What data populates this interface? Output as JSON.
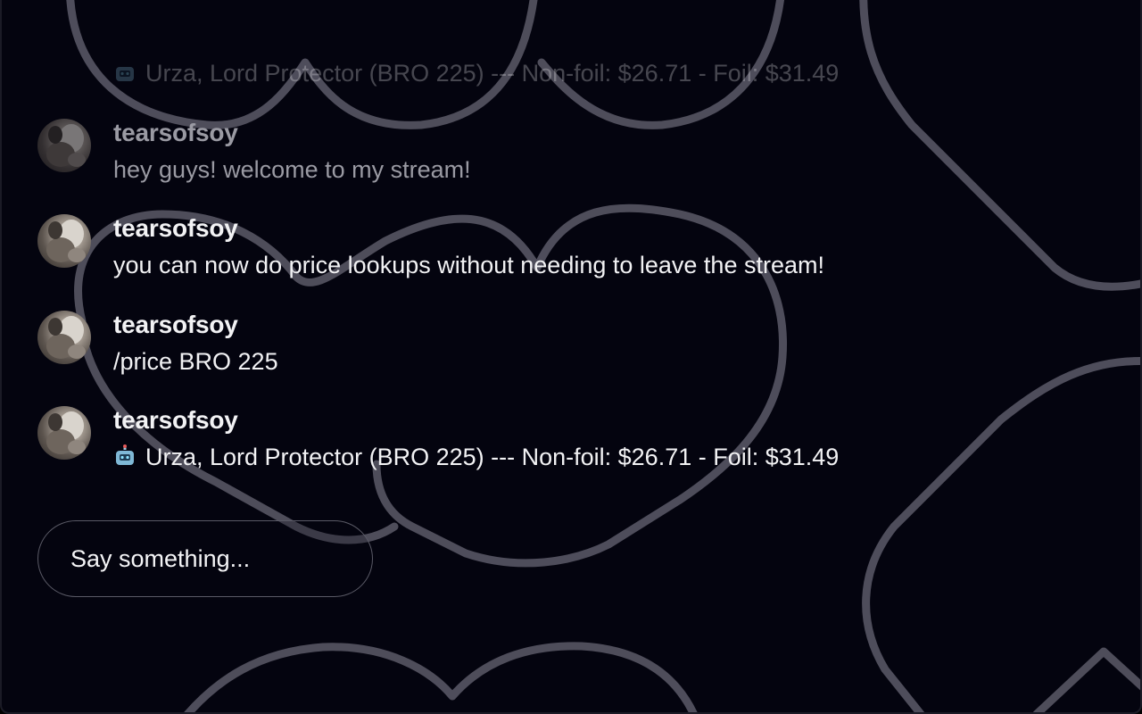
{
  "chat": {
    "messages": [
      {
        "username": "",
        "text": "Urza, Lord Protector (BRO 225) --- Non-foil: $26.71 - Foil: $31.49",
        "icon": "robot-icon",
        "state": "scrolled-off"
      },
      {
        "username": "tearsofsoy",
        "text": "hey guys! welcome to my stream!",
        "state": "faded"
      },
      {
        "username": "tearsofsoy",
        "text": "you can now do price lookups without needing to leave the stream!",
        "state": "normal"
      },
      {
        "username": "tearsofsoy",
        "text": "/price BRO 225",
        "state": "normal"
      },
      {
        "username": "tearsofsoy",
        "text": "Urza, Lord Protector (BRO 225) --- Non-foil: $26.71 - Foil: $31.49",
        "icon": "robot-icon",
        "state": "normal"
      }
    ],
    "input": {
      "placeholder": "Say something..."
    }
  },
  "colors": {
    "background": "#04040f",
    "text": "#f2f2f4",
    "faded_text": "#9a9aa3",
    "decoration_stroke": "#6e6c7a"
  }
}
